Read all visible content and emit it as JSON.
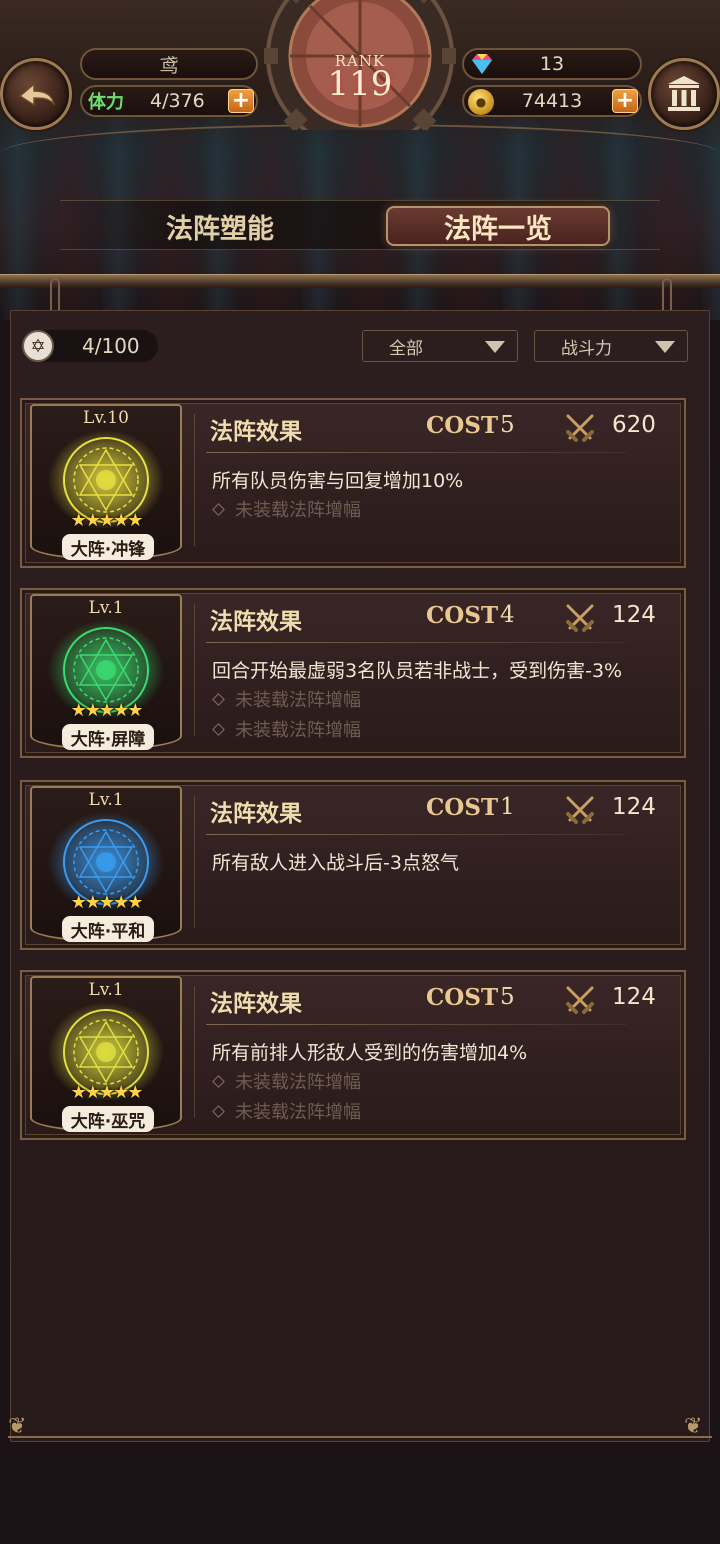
{
  "header": {
    "player_name": "鸢",
    "stamina_label": "体力",
    "stamina_value": "4/376",
    "gems": "13",
    "gold": "74413",
    "rank_label": "RANK",
    "rank_value": "119",
    "plus_symbol": "+"
  },
  "tabs": [
    {
      "label": "法阵塑能",
      "active": false
    },
    {
      "label": "法阵一览",
      "active": true
    }
  ],
  "toolbar": {
    "count": "4/100",
    "filter_label": "全部",
    "sort_label": "战斗力"
  },
  "cards": [
    {
      "level": "Lv.10",
      "name": "大阵·冲锋",
      "stars": "★★★★★",
      "effect_title": "法阵效果",
      "cost_label": "COST",
      "cost": "5",
      "power": "620",
      "description": "所有队员伤害与回复增加10%",
      "slots": [
        "未装载法阵增幅"
      ],
      "glow_color": "#e8e040"
    },
    {
      "level": "Lv.1",
      "name": "大阵·屏障",
      "stars": "★★★★★",
      "effect_title": "法阵效果",
      "cost_label": "COST",
      "cost": "4",
      "power": "124",
      "description": "回合开始最虚弱3名队员若非战士，受到伤害-3%",
      "slots": [
        "未装载法阵增幅",
        "未装载法阵增幅"
      ],
      "glow_color": "#3adc70"
    },
    {
      "level": "Lv.1",
      "name": "大阵·平和",
      "stars": "★★★★★",
      "effect_title": "法阵效果",
      "cost_label": "COST",
      "cost": "1",
      "power": "124",
      "description": "所有敌人进入战斗后-3点怒气",
      "slots": [],
      "glow_color": "#3a9cf0"
    },
    {
      "level": "Lv.1",
      "name": "大阵·巫咒",
      "stars": "★★★★★",
      "effect_title": "法阵效果",
      "cost_label": "COST",
      "cost": "5",
      "power": "124",
      "description": "所有前排人形敌人受到的伤害增加4%",
      "slots": [
        "未装载法阵增幅",
        "未装载法阵增幅"
      ],
      "glow_color": "#e0e040"
    }
  ]
}
